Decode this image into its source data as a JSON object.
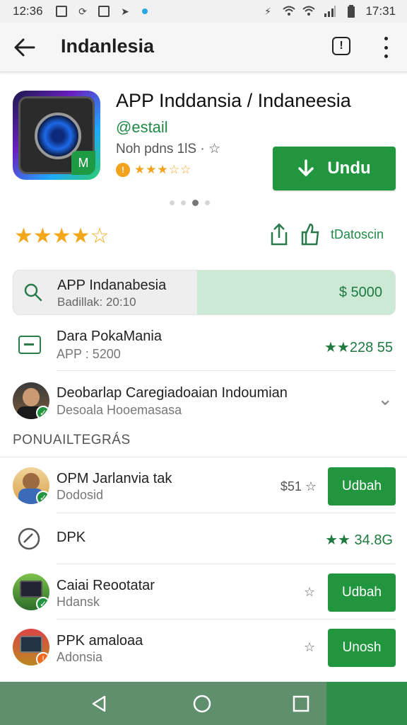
{
  "status_bar": {
    "time_left": "12:36",
    "time_right": "17:31",
    "left_icons": [
      "image-icon",
      "sync-icon",
      "box-icon",
      "send-icon",
      "dot-icon"
    ],
    "right_icons": [
      "nfc-icon",
      "wifi-icon",
      "wifi-icon",
      "signal-icon",
      "battery-icon"
    ],
    "accent": "#2aa3e8"
  },
  "app_bar": {
    "title": "Indanlesia",
    "info_glyph": "!"
  },
  "app": {
    "title": "APP Inddansia / Indaneesia",
    "developer": "@estail",
    "meta": "Noh pdns 1lS · ☆",
    "badge_glyph": "M",
    "rating_stars": "★★★☆☆",
    "install_label": "Undu"
  },
  "carousel": {
    "count": 4,
    "active": 2
  },
  "rating": {
    "stars": "★★★★☆",
    "stars_label": "tDatoscin"
  },
  "highlight": {
    "title": "APP Indanabesia",
    "subtitle": "Badillak: 20:10",
    "price": "$ 5000"
  },
  "rows": [
    {
      "title": "Dara PokaMania",
      "subtitle": "APP : 5200",
      "right": "★★228 55"
    },
    {
      "title": "Deobarlap Caregiadoaian Indoumian",
      "subtitle": "Desoala Hooemasasa",
      "right": "⌄"
    }
  ],
  "section_label": "PONUAILTEGRÁS",
  "recommend": [
    {
      "title": "OPM Jarlanvia tak",
      "subtitle": "Dodosid",
      "price": "$51 ☆",
      "button": "Udbah"
    },
    {
      "title": "DPK",
      "subtitle": "",
      "price": "★★ 34.8G",
      "button": ""
    },
    {
      "title": "Caiai Reootatar",
      "subtitle": "Hdansk",
      "price": "☆",
      "button": "Udbah"
    },
    {
      "title": "PPK amaloaa",
      "subtitle": "Adonsia",
      "price": "☆",
      "button": "Unosh"
    }
  ],
  "colors": {
    "brand_green": "#21963f",
    "star_gold": "#f2a81a",
    "highlight_fill": "#cce9d6",
    "nav_bar": "#5f8f6c"
  }
}
